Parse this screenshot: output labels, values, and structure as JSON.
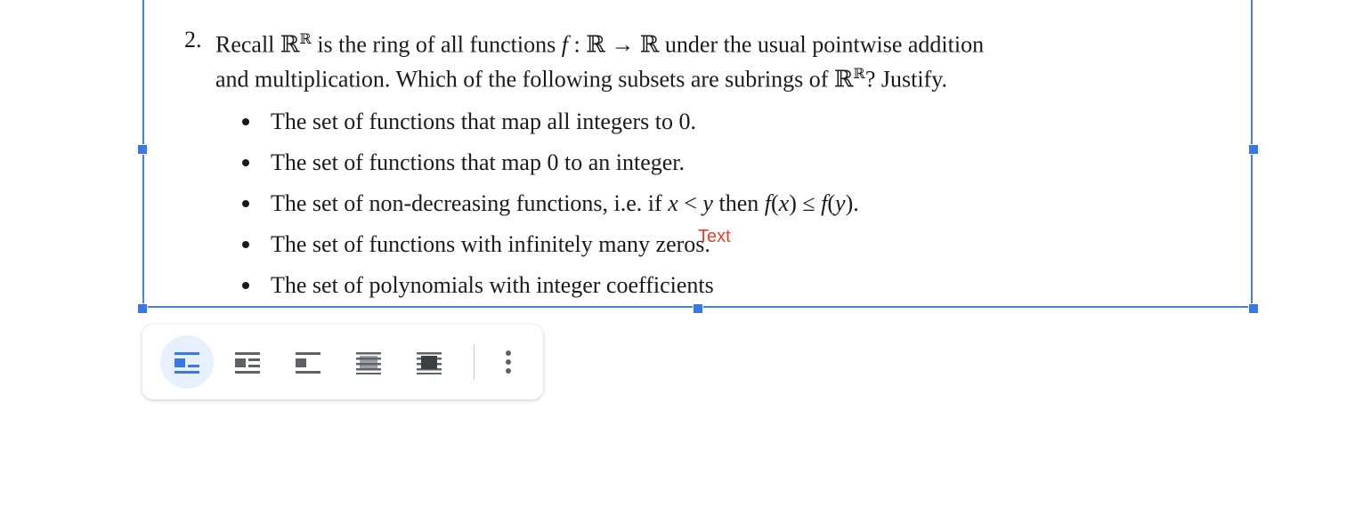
{
  "problem": {
    "number": "2.",
    "text": "Recall ℝ^ℝ is the ring of all functions f : ℝ → ℝ under the usual pointwise addition and multiplication. Which of the following subsets are subrings of ℝ^ℝ? Justify.",
    "line1": "Recall ℝℝ is the ring of all functions f : ℝ → ℝ under the usual pointwise addition",
    "line2": "and multiplication. Which of the following subsets are subrings of ℝℝ? Justify."
  },
  "bullets": [
    "The set of functions that map all integers to 0.",
    "The set of functions that map 0 to an integer.",
    "The set of non-decreasing functions, i.e. if x < y then f(x) ≤ f(y).",
    "The set of functions with infinitely many zeros.",
    "The set of polynomials with integer coefficients"
  ],
  "annotation": "Text",
  "colors": {
    "selection": "#3b78e7",
    "annotation": "#e53e2e",
    "toolbar_active_bg": "#e8f0fe"
  },
  "toolbar": {
    "buttons": [
      {
        "name": "inline",
        "icon": "wrap-inline-icon",
        "active": true
      },
      {
        "name": "wrap-text",
        "icon": "wrap-text-icon",
        "active": false
      },
      {
        "name": "break-text",
        "icon": "break-text-icon",
        "active": false
      },
      {
        "name": "behind-text",
        "icon": "behind-text-icon",
        "active": false
      },
      {
        "name": "in-front-of-text",
        "icon": "in-front-text-icon",
        "active": false
      }
    ],
    "more_icon": "more-vert-icon"
  }
}
